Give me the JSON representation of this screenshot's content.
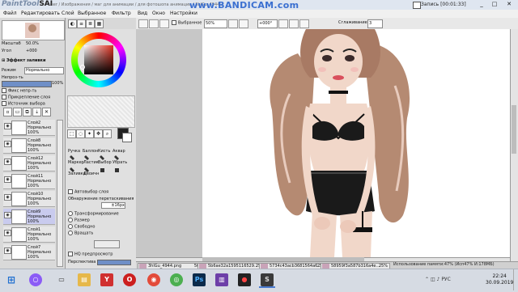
{
  "title_bar": {
    "logo": "PaintTool",
    "logo_strong": "SAI",
    "path": "user / Изображения / маг для анимации / для фотошопа анимации / 3hlGu_4944...",
    "watermark": "www.BANDICAM.com",
    "recording": "Запись [00:01:33]"
  },
  "menu": {
    "items": [
      "Файл",
      "Редактировать",
      "Слой",
      "Выбранное",
      "Фильтр",
      "Вид",
      "Окно",
      "Настройки"
    ]
  },
  "toolbar": {
    "selection_label": "Выбранное",
    "zoom": "50%",
    "rotation": "+000°",
    "smoothing_label": "Сглаживание",
    "smoothing_value": "3"
  },
  "left_panel": {
    "scale_label": "Масштаб",
    "scale_value": "50.0%",
    "angle_label": "Угол",
    "angle_value": "+000",
    "effect_label": "Эффект заливки",
    "mode_label": "Режим",
    "mode_value": "Нормально",
    "opacity_label": "Непроз-ть",
    "opacity_value": "100%",
    "opacity_fraction": 1.0,
    "checks": [
      "Фикс непр-ть",
      "Прикрепление слоя",
      "Источник выбора"
    ]
  },
  "layers": [
    {
      "name": "Слой2",
      "mode": "Нормально",
      "opacity": "100%",
      "selected": false
    },
    {
      "name": "Слой8",
      "mode": "Нормально",
      "opacity": "100%",
      "selected": false
    },
    {
      "name": "Слой12",
      "mode": "Нормально",
      "opacity": "100%",
      "selected": false
    },
    {
      "name": "Слой11",
      "mode": "Нормально",
      "opacity": "100%",
      "selected": false
    },
    {
      "name": "Слой10",
      "mode": "Нормально",
      "opacity": "100%",
      "selected": false
    },
    {
      "name": "Слой9",
      "mode": "Нормально",
      "opacity": "100%",
      "selected": true
    },
    {
      "name": "Слой1",
      "mode": "Нормально",
      "opacity": "100%",
      "selected": false
    },
    {
      "name": "Слой7",
      "mode": "Нормально",
      "opacity": "100%",
      "selected": false
    }
  ],
  "tools": {
    "row1": [
      "Ручка",
      "Баллон",
      "Кисть",
      "Аквар"
    ],
    "row2": [
      "Маркер",
      "Ластик",
      "Выбор",
      "Убрать"
    ],
    "row3": [
      "Заливка",
      "Двоичн"
    ]
  },
  "options": {
    "auto_select": "Автовыбор слоя",
    "overlap_label": "Обнаружение перетаскивания",
    "overlap_value": "±16px",
    "transform": "Трансформирование",
    "resize": "Размер",
    "free": "Свободно",
    "rotate": "Вращать",
    "hq_preview": "HQ предпросмотр",
    "perspective": "Перспектива"
  },
  "doc_tabs": [
    {
      "name": "3hlGu_4944.png",
      "zoom": "50%"
    },
    {
      "name": "5b6ae32a1595116529...",
      "zoom": "25%"
    },
    {
      "name": "5734c43acb3681564a6...",
      "zoom": "25%"
    },
    {
      "name": "58959f3a587b316a4e...",
      "zoom": "25%"
    }
  ],
  "status": {
    "memory": "Использование памяти:47% (Исп47% И:178МБ)"
  },
  "taskbar": {
    "time": "22:24",
    "date": "30.09.2019",
    "lang": "РУС"
  },
  "colors": {
    "accent": "#4a7bd0",
    "selected_layer": "#c9cbee",
    "hair": "#b58a72",
    "skin": "#f1d7c9"
  }
}
